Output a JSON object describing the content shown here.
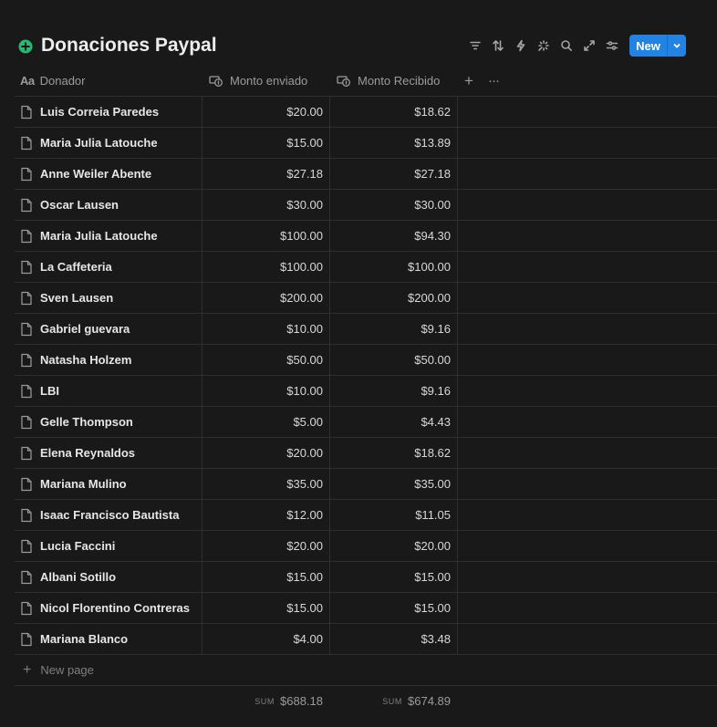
{
  "header": {
    "title": "Donaciones Paypal",
    "title_icon": "plus-circle-icon",
    "accent_color": "#2383e2",
    "icon_color": "#2bb673",
    "toolbar_icons": [
      "filter-icon",
      "sort-icon",
      "automation-icon",
      "ai-sparkle-icon",
      "search-icon",
      "expand-icon",
      "settings-icon"
    ],
    "new_button_label": "New"
  },
  "table": {
    "columns": [
      {
        "label": "Donador",
        "icon": "Aa"
      },
      {
        "label": "Monto enviado",
        "icon": "currency-icon"
      },
      {
        "label": "Monto Recibido",
        "icon": "currency-icon"
      }
    ],
    "add_column": "+",
    "more_options": "···",
    "rows": [
      {
        "name": "Luis Correia Paredes",
        "sent": "$20.00",
        "received": "$18.62"
      },
      {
        "name": "Maria Julia Latouche",
        "sent": "$15.00",
        "received": "$13.89"
      },
      {
        "name": "Anne Weiler Abente",
        "sent": "$27.18",
        "received": "$27.18"
      },
      {
        "name": "Oscar Lausen",
        "sent": "$30.00",
        "received": "$30.00"
      },
      {
        "name": "Maria Julia Latouche",
        "sent": "$100.00",
        "received": "$94.30"
      },
      {
        "name": "La Caffeteria",
        "sent": "$100.00",
        "received": "$100.00"
      },
      {
        "name": "Sven Lausen",
        "sent": "$200.00",
        "received": "$200.00"
      },
      {
        "name": "Gabriel guevara",
        "sent": "$10.00",
        "received": "$9.16"
      },
      {
        "name": "Natasha Holzem",
        "sent": "$50.00",
        "received": "$50.00"
      },
      {
        "name": "LBI",
        "sent": "$10.00",
        "received": "$9.16"
      },
      {
        "name": "Gelle Thompson",
        "sent": "$5.00",
        "received": "$4.43"
      },
      {
        "name": "Elena Reynaldos",
        "sent": "$20.00",
        "received": "$18.62"
      },
      {
        "name": "Mariana Mulino",
        "sent": "$35.00",
        "received": "$35.00"
      },
      {
        "name": "Isaac Francisco Bautista",
        "sent": "$12.00",
        "received": "$11.05"
      },
      {
        "name": "Lucia Faccini",
        "sent": "$20.00",
        "received": "$20.00"
      },
      {
        "name": "Albani Sotillo",
        "sent": "$15.00",
        "received": "$15.00"
      },
      {
        "name": "Nicol Florentino Contreras",
        "sent": "$15.00",
        "received": "$15.00"
      },
      {
        "name": "Mariana Blanco",
        "sent": "$4.00",
        "received": "$3.48"
      }
    ],
    "new_page_label": "New page",
    "sum_label": "SUM",
    "sum_sent": "$688.18",
    "sum_received": "$674.89"
  }
}
